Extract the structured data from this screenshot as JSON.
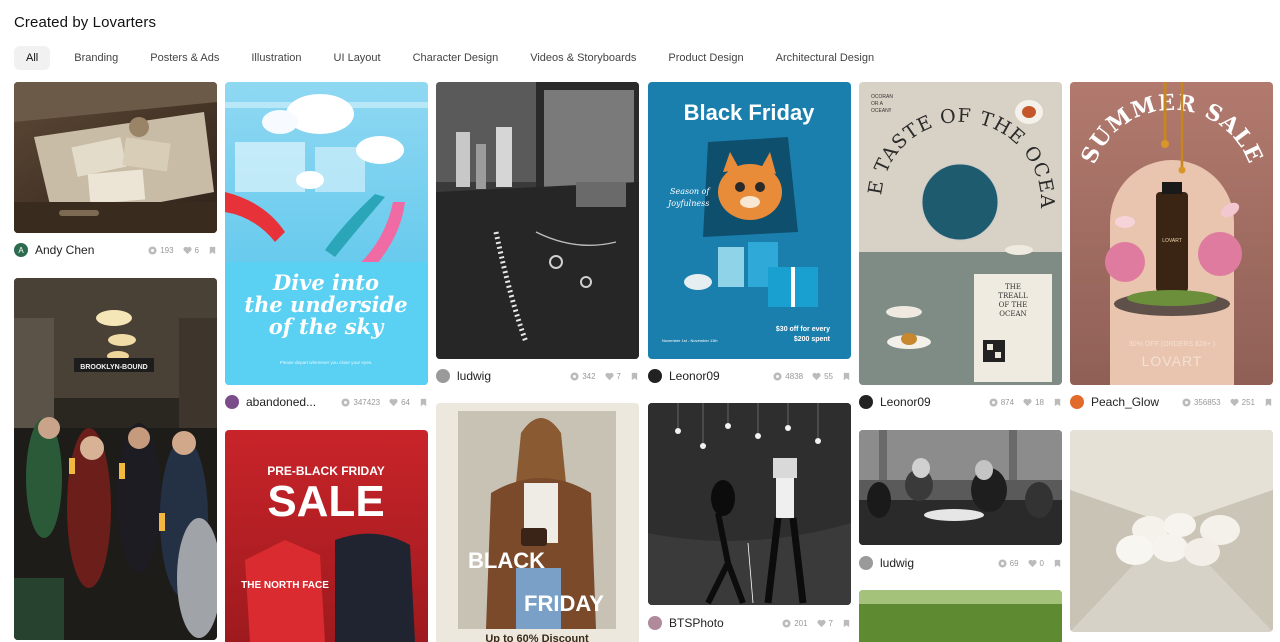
{
  "header": {
    "title": "Created by Lovarters"
  },
  "tabs": [
    {
      "label": "All"
    },
    {
      "label": "Branding"
    },
    {
      "label": "Posters & Ads"
    },
    {
      "label": "Illustration"
    },
    {
      "label": "UI Layout"
    },
    {
      "label": "Character Design"
    },
    {
      "label": "Videos & Storyboards"
    },
    {
      "label": "Product Design"
    },
    {
      "label": "Architectural Design"
    }
  ],
  "cards": {
    "drawer": {
      "author": "Andy Chen",
      "avatar_letter": "A",
      "views": "193",
      "likes": "6"
    },
    "pool": {
      "author": "abandoned...",
      "views": "347423",
      "likes": "64",
      "line1": "Dive into",
      "line2": "the underside",
      "line3": "of the sky",
      "caption": "Please depart whenever you close your eyes."
    },
    "jewelry": {
      "author": "ludwig",
      "views": "342",
      "likes": "7"
    },
    "blackfriday": {
      "author": "Leonor09",
      "views": "4838",
      "likes": "55",
      "headline": "Black Friday",
      "script1": "Season of",
      "script2": "Joyfulness",
      "offer1": "$30 off for every",
      "offer2": "$200 spent",
      "dates": "November 1st - November 11th"
    },
    "ocean": {
      "author": "Leonor09",
      "views": "874",
      "likes": "18",
      "arc": "THE TASTE OF THE OCEAN",
      "corner1": "OCORAN",
      "corner2": "OR A",
      "corner3": "OCEAN!!",
      "card1": "THE",
      "card2": "TREALL",
      "card3": "OF THE",
      "card4": "OCEAN"
    },
    "summer": {
      "author": "Peach_Glow",
      "views": "356853",
      "likes": "251",
      "arc": "SUMMER SALE",
      "offer": "30% OFF (ORDERS $28+ )",
      "brand": "LOVART",
      "bottle_label": "LOVART"
    },
    "hogwarts": {
      "sign": "BROOKLYN-BOUND"
    },
    "saleposter": {
      "line1": "PRE-BLACK FRIDAY",
      "line2": "SALE",
      "shirt": "THE NORTH FACE"
    },
    "fashion": {
      "word1": "BLACK",
      "word2": "FRIDAY",
      "footer": "Up to 60% Discount"
    },
    "dance": {
      "author": "BTSPhoto",
      "views": "201",
      "likes": "7"
    },
    "cafe": {
      "author": "ludwig",
      "views": "69",
      "likes": "0"
    }
  }
}
